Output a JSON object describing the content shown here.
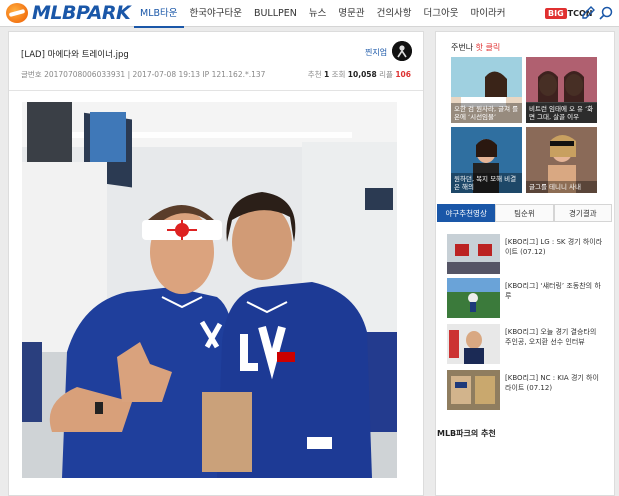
{
  "header": {
    "logo_text": "MLBPARK",
    "nav": [
      "MLB타운",
      "한국야구타운",
      "BULLPEN",
      "뉴스",
      "명문관",
      "건의사항",
      "더그아웃",
      "마이라커"
    ],
    "bigtcon": {
      "big": "BIG",
      "tcon": "TCON"
    },
    "accent": "#1a57a8"
  },
  "post": {
    "title": "[LAD] 마에다와 트레이너.jpg",
    "author": "찐지업",
    "meta": "글번호 20170708006033931 | 2017-07-08 19:13 IP 121.162.*.137",
    "rec_label": "추천",
    "rec_value": "1",
    "views_label": "조회",
    "views_value": "10,058",
    "replies_label": "리플",
    "replies_value": "106"
  },
  "sidebar": {
    "hot_prefix": "주번나",
    "hot_label": "핫 클릭",
    "thumbs": [
      {
        "caption": "오한 검 원사라, 글쳐 를 온에 ‘시선임물’"
      },
      {
        "caption": "비트런 임태에 오 유 ‘화면 그대, 살골 이우"
      },
      {
        "caption": "원하던, 복지 모해 비결은 해의"
      },
      {
        "caption": "글그를 테니니 사내"
      }
    ],
    "tabs": [
      "야구추천영상",
      "팀순위",
      "경기결과"
    ],
    "videos": [
      {
        "title": "[KBO리그] LG : SK 경기 하이라이트 (07.12)"
      },
      {
        "title": "[KBO리그] ‘섀터링’ 조동찬의 하루"
      },
      {
        "title": "[KBO리그] 오늘 경기 결승타의 주인공, 오지환 선수 인터뷰"
      },
      {
        "title": "[KBO리그] NC : KIA 경기 하이라이트 (07.12)"
      }
    ],
    "rec_heading": "MLB파크의 추천"
  }
}
